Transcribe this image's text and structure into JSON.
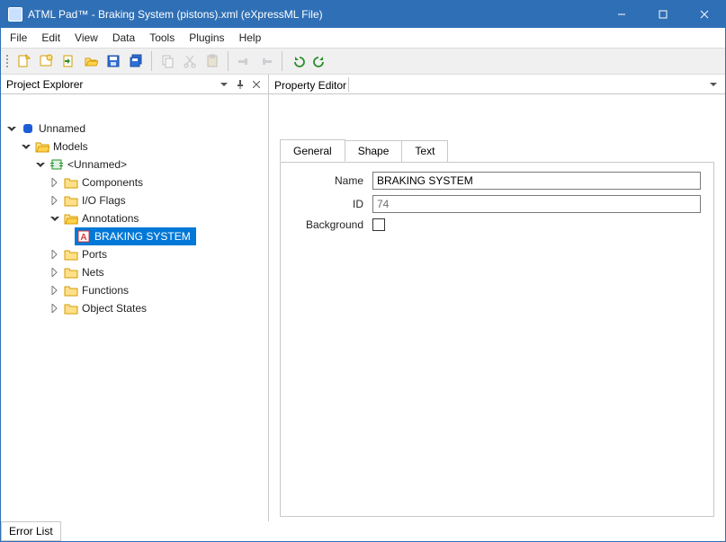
{
  "window": {
    "title": "ATML Pad™ - Braking System (pistons).xml (eXpressML File)"
  },
  "menus": [
    "File",
    "Edit",
    "View",
    "Data",
    "Tools",
    "Plugins",
    "Help"
  ],
  "panels": {
    "explorer_title": "Project Explorer",
    "property_title": "Property Editor",
    "error_list": "Error List"
  },
  "tree": {
    "root": "Unnamed",
    "models": "Models",
    "unnamed_model": "<Unnamed>",
    "components": "Components",
    "ioflags": "I/O Flags",
    "annotations": "Annotations",
    "braking_system": "BRAKING SYSTEM",
    "ports": "Ports",
    "nets": "Nets",
    "functions": "Functions",
    "object_states": "Object States"
  },
  "prop_tabs": {
    "general": "General",
    "shape": "Shape",
    "text": "Text"
  },
  "form": {
    "name_label": "Name",
    "name_value": "BRAKING SYSTEM",
    "id_label": "ID",
    "id_value": "74",
    "background_label": "Background",
    "background_checked": false
  }
}
